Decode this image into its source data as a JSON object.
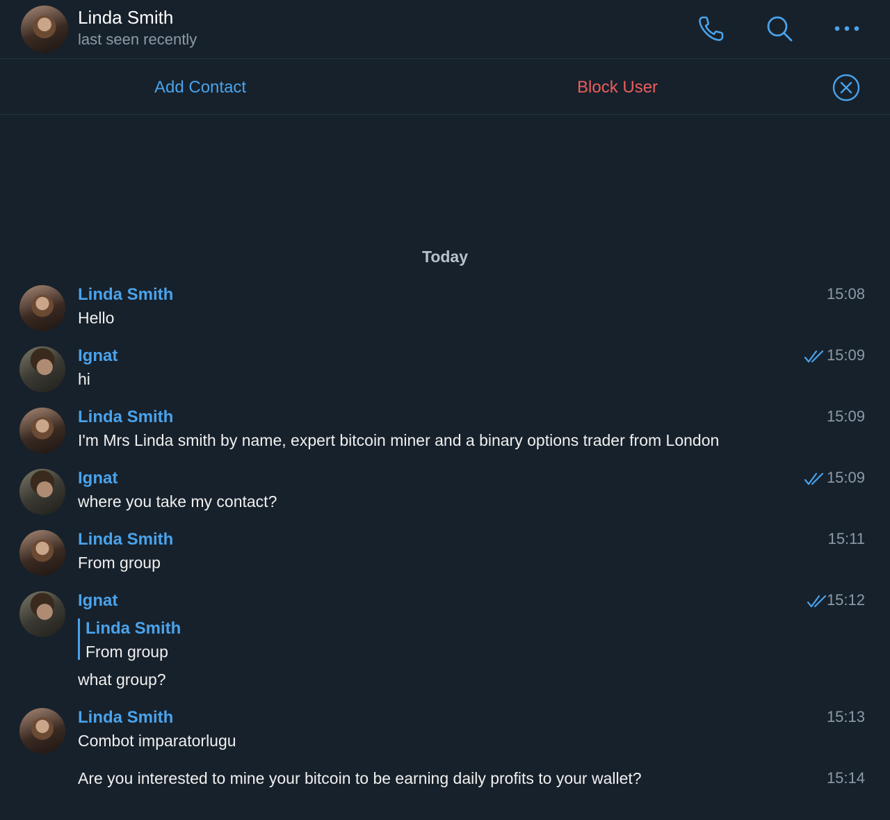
{
  "header": {
    "name": "Linda Smith",
    "status": "last seen recently"
  },
  "actions": {
    "add_contact": "Add Contact",
    "block_user": "Block User"
  },
  "day_label": "Today",
  "messages": [
    {
      "sender": "Linda Smith",
      "text": "Hello",
      "time": "15:08"
    },
    {
      "sender": "Ignat",
      "text": "hi",
      "time": "15:09"
    },
    {
      "sender": "Linda Smith",
      "text": "I'm Mrs Linda smith  by name, expert bitcoin miner and a binary options trader from London",
      "time": "15:09"
    },
    {
      "sender": "Ignat",
      "text": "where you take my contact?",
      "time": "15:09"
    },
    {
      "sender": "Linda Smith",
      "text": "From group",
      "time": "15:11"
    },
    {
      "sender": "Ignat",
      "reply_to": {
        "sender": "Linda Smith",
        "text": "From group"
      },
      "text": "what group?",
      "time": "15:12"
    },
    {
      "sender": "Linda Smith",
      "text": "Combot imparatorlugu",
      "time": "15:13"
    },
    {
      "text": "Are you interested to mine your bitcoin to be earning daily profits to your wallet?",
      "time": "15:14"
    }
  ],
  "colors": {
    "background": "#17212b",
    "accent": "#4aa3ec",
    "danger": "#ec5e5e",
    "muted": "#8d9ba8"
  }
}
